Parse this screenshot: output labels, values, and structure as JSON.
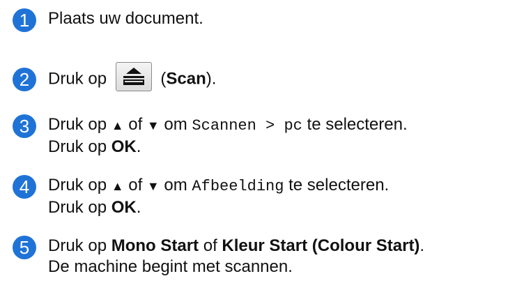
{
  "steps": [
    {
      "number": "1",
      "text": "Plaats uw document."
    },
    {
      "number": "2",
      "pre": "Druk op",
      "paren_open": "(",
      "bold": "Scan",
      "paren_close": ")."
    },
    {
      "number": "3",
      "pre": "Druk op",
      "up": "▲",
      "of": "of",
      "down": "▼",
      "om": "om",
      "code": "Scannen > pc",
      "post": "te selecteren.",
      "line2_pre": "Druk op",
      "line2_bold": "OK",
      "line2_post": "."
    },
    {
      "number": "4",
      "pre": "Druk op",
      "up": "▲",
      "of": "of",
      "down": "▼",
      "om": "om",
      "code": "Afbeelding",
      "post": "te selecteren.",
      "line2_pre": "Druk op",
      "line2_bold": "OK",
      "line2_post": "."
    },
    {
      "number": "5",
      "pre": "Druk op",
      "bold1": "Mono Start",
      "of": "of",
      "bold2": "Kleur Start (Colour Start)",
      "post": ".",
      "line2": "De machine begint met scannen."
    }
  ],
  "icons": {
    "scan_button": "scan-icon"
  },
  "colors": {
    "badge": "#1f73d6",
    "text": "#111111"
  }
}
